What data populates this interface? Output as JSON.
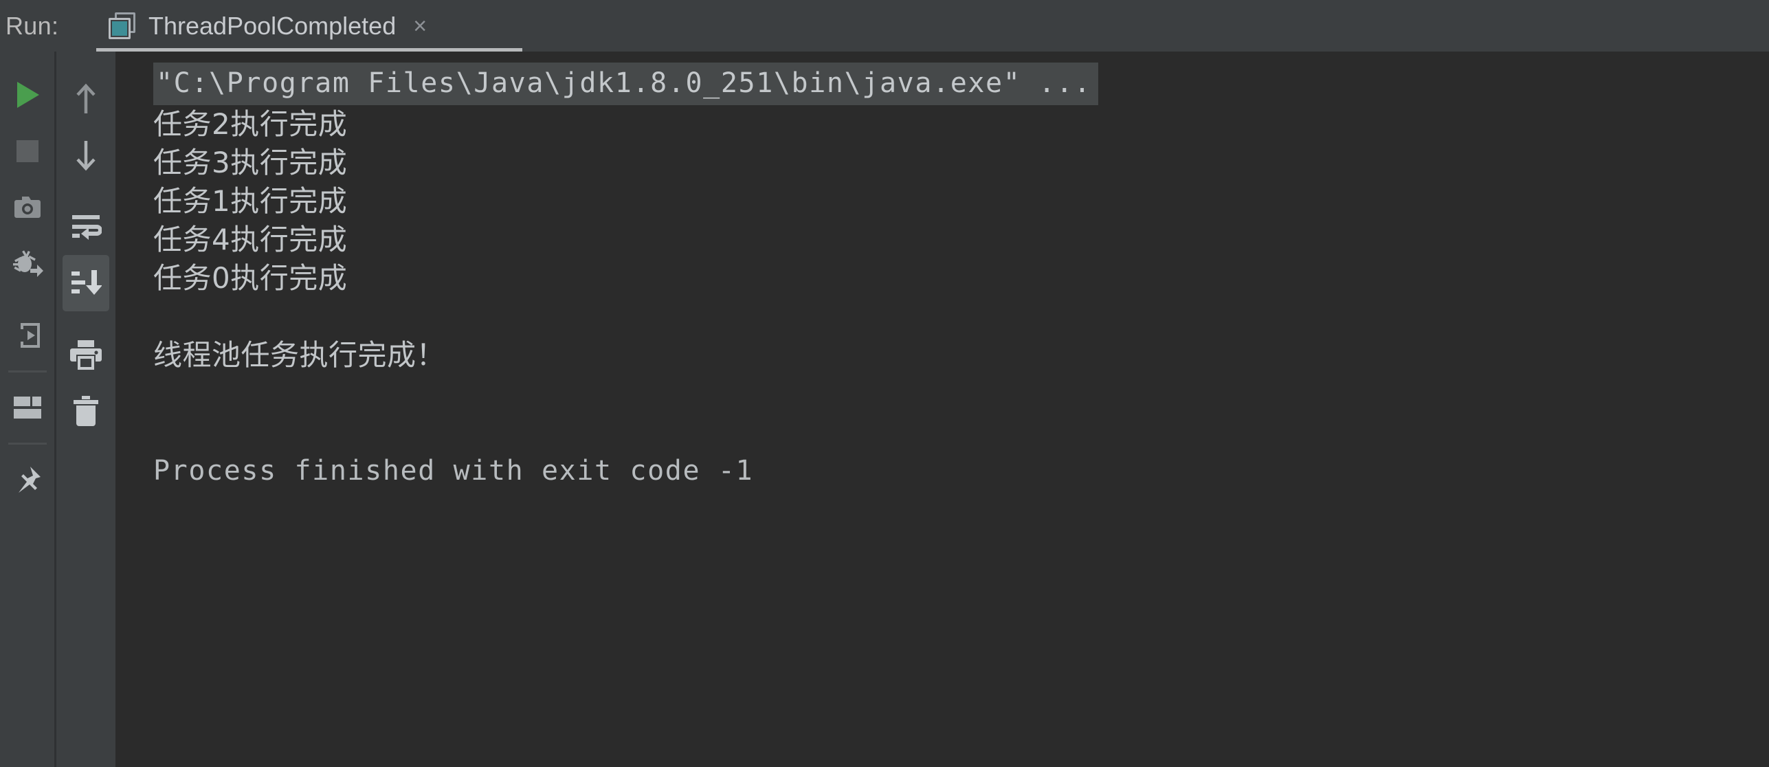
{
  "header": {
    "run_label": "Run:",
    "tab": {
      "title": "ThreadPoolCompleted",
      "close_label": "×",
      "icon": "run-configuration-icon"
    }
  },
  "toolbar_primary": {
    "items": [
      {
        "name": "rerun-button",
        "icon": "play-triangle-icon",
        "tooltip": "Rerun"
      },
      {
        "name": "stop-button",
        "icon": "stop-square-icon",
        "tooltip": "Stop"
      },
      {
        "name": "dump-threads-button",
        "icon": "camera-icon",
        "tooltip": "Dump Threads"
      },
      {
        "name": "restore-layout-button",
        "icon": "bug-arrow-icon",
        "tooltip": "Restore Layout"
      },
      {
        "name": "step-into-button",
        "icon": "arrow-into-box-icon",
        "tooltip": "Step"
      },
      {
        "name": "layout-settings-button",
        "icon": "layout-panels-icon",
        "tooltip": "Layout"
      },
      {
        "name": "pin-tab-button",
        "icon": "pin-icon",
        "tooltip": "Pin Tab"
      }
    ]
  },
  "toolbar_secondary": {
    "items": [
      {
        "name": "up-button",
        "icon": "arrow-up-icon",
        "tooltip": "Up the Stack Trace"
      },
      {
        "name": "down-button",
        "icon": "arrow-down-icon",
        "tooltip": "Down the Stack Trace"
      },
      {
        "name": "soft-wrap-button",
        "icon": "soft-wrap-icon",
        "tooltip": "Use Soft Wraps"
      },
      {
        "name": "scroll-to-end-button",
        "icon": "scroll-to-end-icon",
        "tooltip": "Scroll to the end",
        "active": true
      },
      {
        "name": "print-button",
        "icon": "printer-icon",
        "tooltip": "Print"
      },
      {
        "name": "clear-all-button",
        "icon": "trash-icon",
        "tooltip": "Clear All"
      }
    ]
  },
  "console": {
    "command_line": "\"C:\\Program Files\\Java\\jdk1.8.0_251\\bin\\java.exe\" ...",
    "lines": [
      {
        "text": "任务2执行完成",
        "cjk": true
      },
      {
        "text": "任务3执行完成",
        "cjk": true
      },
      {
        "text": "任务1执行完成",
        "cjk": true
      },
      {
        "text": "任务4执行完成",
        "cjk": true
      },
      {
        "text": "任务0执行完成",
        "cjk": true
      },
      {
        "text": "",
        "cjk": false
      },
      {
        "text": "线程池任务执行完成！",
        "cjk": true
      },
      {
        "text": "",
        "cjk": false
      },
      {
        "text": "Process finished with exit code -1",
        "cjk": false
      }
    ],
    "exit_code": "-1"
  },
  "colors": {
    "toolbar_background": "#3c3f41",
    "console_background": "#2b2b2b",
    "console_text": "#b8bcbf",
    "command_highlight": "#46494a",
    "run_green": "#4a9e4e",
    "tab_icon_teal": "#3e8e96",
    "active_button": "#4e5254"
  }
}
